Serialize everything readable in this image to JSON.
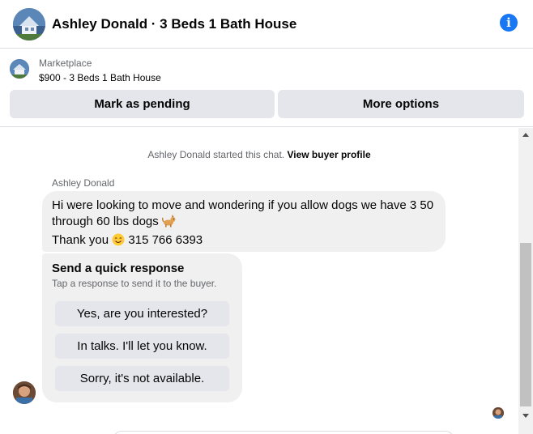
{
  "header": {
    "title": "Ashley Donald · 3 Beds 1 Bath House",
    "info_icon": "info-icon",
    "info_glyph": "i"
  },
  "marketplace": {
    "label": "Marketplace",
    "item": "$900 - 3 Beds 1 Bath House",
    "mark_pending_label": "Mark as pending",
    "more_options_label": "More options"
  },
  "chat": {
    "system_prefix": "Ashley Donald started this chat. ",
    "system_link": "View buyer profile",
    "sender_name": "Ashley Donald",
    "message_line_1": "Hi were looking to move and wondering if you allow dogs we have 3 50",
    "message_line_2": "through 60 lbs dogs",
    "message_line_3_before": "Thank you",
    "message_line_3_after": "315 766 6393",
    "quick_response": {
      "title": "Send a quick response",
      "subtitle": "Tap a response to send it to the buyer.",
      "options": [
        "Yes, are you interested?",
        "In talks. I'll let you know.",
        "Sorry, it's not available."
      ]
    }
  },
  "colors": {
    "accent": "#1877f2",
    "button_bg": "#e4e6eb",
    "bubble_bg": "#f0f0f0",
    "secondary_text": "#65676b"
  }
}
